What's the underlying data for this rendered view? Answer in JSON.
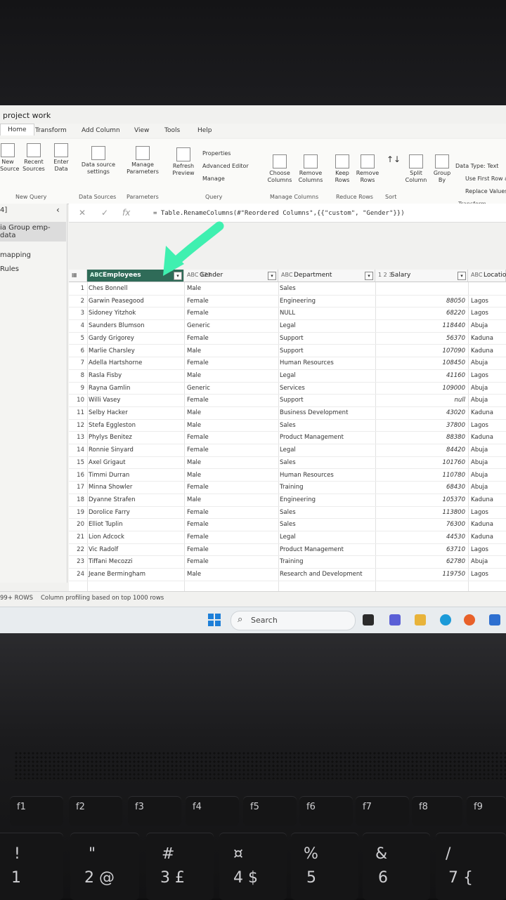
{
  "window": {
    "title": "project work"
  },
  "tabs": [
    "Home",
    "Transform",
    "Add Column",
    "View",
    "Tools",
    "Help"
  ],
  "ribbon": {
    "new_source": "New\nSource",
    "recent_sources": "Recent\nSources",
    "enter_data": "Enter\nData",
    "group_new_query": "New Query",
    "data_source_settings": "Data source\nsettings",
    "group_data_sources": "Data Sources",
    "manage_parameters": "Manage\nParameters",
    "group_parameters": "Parameters",
    "refresh_preview": "Refresh\nPreview",
    "properties": "Properties",
    "advanced_editor": "Advanced Editor",
    "manage": "Manage",
    "group_query": "Query",
    "choose_columns": "Choose\nColumns",
    "remove_columns": "Remove\nColumns",
    "group_manage_columns": "Manage Columns",
    "keep_rows": "Keep\nRows",
    "remove_rows": "Remove\nRows",
    "group_reduce_rows": "Reduce Rows",
    "group_sort": "Sort",
    "split_column": "Split\nColumn",
    "group_by": "Group\nBy",
    "data_type": "Data Type: Text",
    "use_first_row": "Use First Row a",
    "replace_values": "Replace Values",
    "group_transform": "Transform"
  },
  "left_pane": {
    "count": "4]",
    "items": [
      "ia Group emp-data",
      "mapping",
      "Rules"
    ]
  },
  "formula_bar": {
    "text": "= Table.RenameColumns(#\"Reordered Columns\",{{\"custom\", \"Gender\"}})"
  },
  "columns": [
    {
      "type": "ABC",
      "label": "Employees"
    },
    {
      "type": "ABC 123",
      "label": "Gender"
    },
    {
      "type": "ABC",
      "label": "Department"
    },
    {
      "type": "1 2 3",
      "label": "Salary"
    },
    {
      "type": "ABC",
      "label": "Location"
    }
  ],
  "rows": [
    {
      "n": "1",
      "emp": "Ches Bonnell",
      "gen": "Male",
      "dep": "Sales",
      "sal": "",
      "loc": ""
    },
    {
      "n": "2",
      "emp": "Garwin Peasegood",
      "gen": "Female",
      "dep": "Engineering",
      "sal": "88050",
      "loc": "Lagos"
    },
    {
      "n": "3",
      "emp": "Sidoney Yitzhok",
      "gen": "Female",
      "dep": "NULL",
      "sal": "68220",
      "loc": "Lagos"
    },
    {
      "n": "4",
      "emp": "Saunders Blumson",
      "gen": "Generic",
      "dep": "Legal",
      "sal": "118440",
      "loc": "Abuja"
    },
    {
      "n": "5",
      "emp": "Gardy Grigorey",
      "gen": "Female",
      "dep": "Support",
      "sal": "56370",
      "loc": "Kaduna"
    },
    {
      "n": "6",
      "emp": "Marlie Charsley",
      "gen": "Male",
      "dep": "Support",
      "sal": "107090",
      "loc": "Kaduna"
    },
    {
      "n": "7",
      "emp": "Adella Hartshorne",
      "gen": "Female",
      "dep": "Human Resources",
      "sal": "108450",
      "loc": "Abuja"
    },
    {
      "n": "8",
      "emp": "Rasla Fisby",
      "gen": "Male",
      "dep": "Legal",
      "sal": "41160",
      "loc": "Lagos"
    },
    {
      "n": "9",
      "emp": "Rayna Gamlin",
      "gen": "Generic",
      "dep": "Services",
      "sal": "109000",
      "loc": "Abuja"
    },
    {
      "n": "10",
      "emp": "Willi Vasey",
      "gen": "Female",
      "dep": "Support",
      "sal": "null",
      "loc": "Abuja"
    },
    {
      "n": "11",
      "emp": "Selby Hacker",
      "gen": "Male",
      "dep": "Business Development",
      "sal": "43020",
      "loc": "Kaduna"
    },
    {
      "n": "12",
      "emp": "Stefa Eggleston",
      "gen": "Male",
      "dep": "Sales",
      "sal": "37800",
      "loc": "Lagos"
    },
    {
      "n": "13",
      "emp": "Phylys Benitez",
      "gen": "Female",
      "dep": "Product Management",
      "sal": "88380",
      "loc": "Kaduna"
    },
    {
      "n": "14",
      "emp": "Ronnie Sinyard",
      "gen": "Female",
      "dep": "Legal",
      "sal": "84420",
      "loc": "Abuja"
    },
    {
      "n": "15",
      "emp": "Axel Grigaut",
      "gen": "Male",
      "dep": "Sales",
      "sal": "101760",
      "loc": "Abuja"
    },
    {
      "n": "16",
      "emp": "Timmi Durran",
      "gen": "Male",
      "dep": "Human Resources",
      "sal": "110780",
      "loc": "Abuja"
    },
    {
      "n": "17",
      "emp": "Minna Showler",
      "gen": "Female",
      "dep": "Training",
      "sal": "68430",
      "loc": "Abuja"
    },
    {
      "n": "18",
      "emp": "Dyanne Strafen",
      "gen": "Male",
      "dep": "Engineering",
      "sal": "105370",
      "loc": "Kaduna"
    },
    {
      "n": "19",
      "emp": "Dorolice Farry",
      "gen": "Female",
      "dep": "Sales",
      "sal": "113800",
      "loc": "Lagos"
    },
    {
      "n": "20",
      "emp": "Elliot Tuplin",
      "gen": "Female",
      "dep": "Sales",
      "sal": "76300",
      "loc": "Kaduna"
    },
    {
      "n": "21",
      "emp": "Lion Adcock",
      "gen": "Female",
      "dep": "Legal",
      "sal": "44530",
      "loc": "Kaduna"
    },
    {
      "n": "22",
      "emp": "Vic Radolf",
      "gen": "Female",
      "dep": "Product Management",
      "sal": "63710",
      "loc": "Lagos"
    },
    {
      "n": "23",
      "emp": "Tiffani Mecozzi",
      "gen": "Female",
      "dep": "Training",
      "sal": "62780",
      "loc": "Abuja"
    },
    {
      "n": "24",
      "emp": "Jeane Bermingham",
      "gen": "Male",
      "dep": "Research and Development",
      "sal": "119750",
      "loc": "Lagos"
    }
  ],
  "status_bar": {
    "rows": "99+ ROWS",
    "profiling": "Column profiling based on top 1000 rows"
  },
  "taskbar": {
    "search_placeholder": "Search"
  },
  "keys": {
    "f1": "f1",
    "f2": "f2",
    "f3": "f3",
    "f4": "f4",
    "f5": "f5",
    "f6": "f6",
    "f7": "f7",
    "f8": "f8",
    "f9": "f9",
    "k1_top": "!",
    "k1": "1",
    "k2_top": "\"",
    "k2": "2 @",
    "k3_top": "#",
    "k3": "3 £",
    "k4_top": "¤",
    "k4": "4 $",
    "k5_top": "%",
    "k5": "5",
    "k6_top": "&",
    "k6": "6",
    "k7_top": "/",
    "k7": "7 {"
  },
  "colors": {
    "accent_arrow": "#3ff0b0",
    "selected_header": "#2f6b58"
  }
}
